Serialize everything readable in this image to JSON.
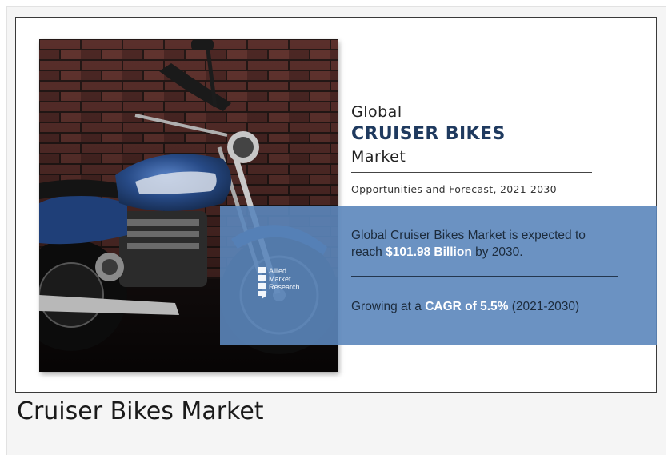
{
  "infographic": {
    "title_line1": "Global",
    "title_line2": "CRUISER BIKES",
    "title_line3": "Market",
    "subtitle": "Opportunities and Forecast, 2021-2030",
    "stat1_prefix": "Global Cruiser Bikes Market is expected to reach ",
    "stat1_value": "$101.98 Billion",
    "stat1_suffix": " by 2030.",
    "stat2_prefix": "Growing at a ",
    "stat2_value": "CAGR of 5.5%",
    "stat2_suffix": " (2021-2030)",
    "logo_line1": "Allied",
    "logo_line2": "Market",
    "logo_line3": "Research"
  },
  "caption": "Cruiser Bikes Market",
  "colors": {
    "brand_navy": "#1f3a5f",
    "band_blue": "#5b86bb",
    "bike_blue": "#274a86",
    "brick": "#5a2f2b"
  },
  "icons": {
    "logo": "allied-market-research-logo-icon"
  }
}
